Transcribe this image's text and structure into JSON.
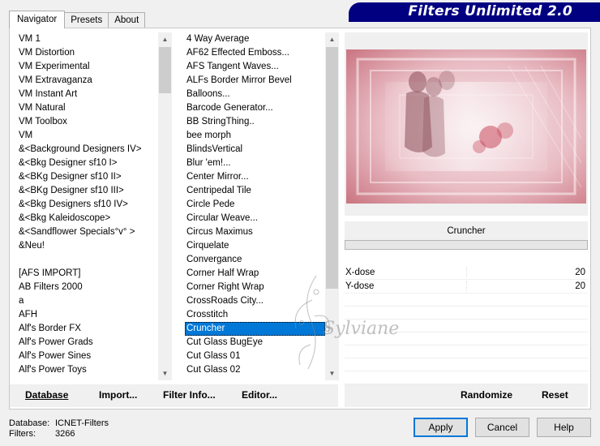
{
  "tabs": [
    {
      "label": "Navigator"
    },
    {
      "label": "Presets"
    },
    {
      "label": "About"
    }
  ],
  "banner_title": "Filters Unlimited 2.0",
  "categories": [
    "VM 1",
    "VM Distortion",
    "VM Experimental",
    "VM Extravaganza",
    "VM Instant Art",
    "VM Natural",
    "VM Toolbox",
    "VM",
    "&<Background Designers IV>",
    "&<Bkg Designer sf10 I>",
    "&<BKg Designer sf10 II>",
    "&<BKg Designer sf10 III>",
    "&<Bkg Designers sf10 IV>",
    "&<Bkg Kaleidoscope>",
    "&<Sandflower Specials°v° >",
    "&Neu!",
    "",
    "[AFS IMPORT]",
    "AB Filters 2000",
    "a",
    "AFH",
    "Alf's Border FX",
    "Alf's Power Grads",
    "Alf's Power Sines",
    "Alf's Power Toys"
  ],
  "filters": [
    "4 Way Average",
    "AF62 Effected Emboss...",
    "AFS Tangent Waves...",
    "ALFs Border Mirror Bevel",
    "Balloons...",
    "Barcode Generator...",
    "BB StringThing..",
    "bee morph",
    "BlindsVertical",
    "Blur 'em!...",
    "Center Mirror...",
    "Centripedal Tile",
    "Circle Pede",
    "Circular Weave...",
    "Circus Maximus",
    "Cirquelate",
    "Convergance",
    "Corner Half Wrap",
    "Corner Right Wrap",
    "CrossRoads City...",
    "Crosstitch",
    "Cruncher",
    "Cut Glass  BugEye",
    "Cut Glass 01",
    "Cut Glass 02"
  ],
  "selected_filter": "Cruncher",
  "left_buttons": {
    "database": "Database",
    "import": "Import...",
    "filter_info": "Filter Info...",
    "editor": "Editor..."
  },
  "right_buttons": {
    "randomize": "Randomize",
    "reset": "Reset"
  },
  "params": [
    {
      "label": "X-dose",
      "value": "20"
    },
    {
      "label": "Y-dose",
      "value": "20"
    }
  ],
  "status": {
    "database_label": "Database:",
    "database_value": "ICNET-Filters",
    "filters_label": "Filters:",
    "filters_value": "3266"
  },
  "dialog_buttons": {
    "apply": "Apply",
    "cancel": "Cancel",
    "help": "Help"
  },
  "watermark_text": "Sylviane",
  "colors": {
    "banner": "#000080",
    "selection": "#0078d7",
    "preview_pink": "#e7a3ad"
  }
}
